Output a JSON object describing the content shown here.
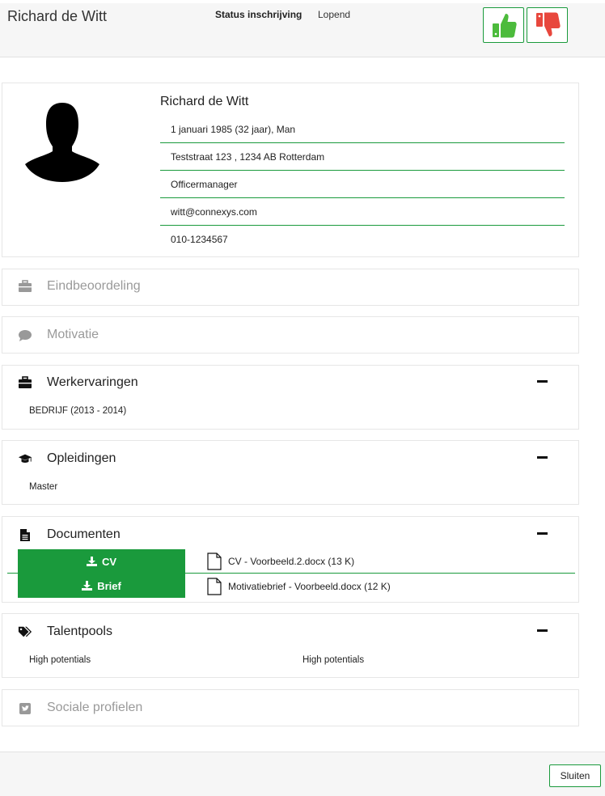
{
  "header": {
    "candidate_name": "Richard de Witt",
    "status_label": "Status inschrijving",
    "status_value": "Lopend",
    "approve_icon": "thumbs-up-icon",
    "reject_icon": "thumbs-down-icon",
    "approve_color": "#4cbb3c",
    "reject_color": "#e8473d"
  },
  "profile": {
    "name": "Richard de Witt",
    "birth": "1 januari 1985 (32 jaar), Man",
    "address": "Teststraat 123 , 1234 AB Rotterdam",
    "job_title": "Officermanager",
    "email": "witt@connexys.com",
    "phone": "010-1234567",
    "avatar_icon": "person-silhouette-icon"
  },
  "sections": {
    "eindbeoordeling": {
      "title": "Eindbeoordeling",
      "icon": "briefcase-icon"
    },
    "motivatie": {
      "title": "Motivatie",
      "icon": "speech-bubble-icon"
    },
    "werkervaringen": {
      "title": "Werkervaringen",
      "icon": "briefcase-icon",
      "items": [
        "BEDRIJF (2013 - 2014)"
      ]
    },
    "opleidingen": {
      "title": "Opleidingen",
      "icon": "graduation-cap-icon",
      "items": [
        "Master"
      ]
    },
    "documenten": {
      "title": "Documenten",
      "icon": "document-icon",
      "cv_button": "CV",
      "brief_button": "Brief",
      "files": [
        "CV - Voorbeeld.2.docx (13 K)",
        "Motivatiebrief - Voorbeeld.docx (12 K)"
      ]
    },
    "talentpools": {
      "title": "Talentpools",
      "icon": "tags-icon",
      "items": [
        "High potentials",
        "High potentials"
      ]
    },
    "sociale_profielen": {
      "title": "Sociale profielen",
      "icon": "twitter-icon"
    }
  },
  "footer": {
    "close_label": "Sluiten"
  },
  "colors": {
    "accent": "#1a9a3c",
    "muted_text": "#9a9a9a"
  }
}
